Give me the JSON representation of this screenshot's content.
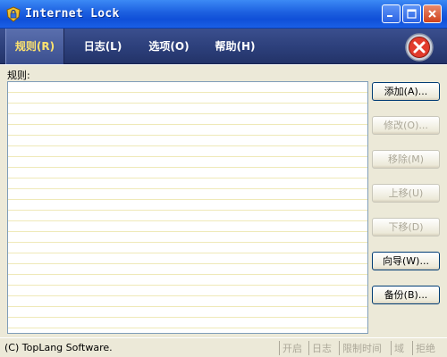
{
  "window": {
    "title": "Internet Lock"
  },
  "menu": {
    "rules": "规则(R)",
    "log": "日志(L)",
    "options": "选项(O)",
    "help": "帮助(H)"
  },
  "rules_panel": {
    "label": "规则:",
    "buttons": {
      "add": "添加(A)...",
      "edit": "修改(O)...",
      "remove": "移除(M)",
      "move_up": "上移(U)",
      "move_down": "下移(D)",
      "wizard": "向导(W)...",
      "backup": "备份(B)..."
    }
  },
  "status": {
    "copyright": "(C) TopLang Software.",
    "segments": [
      "开启",
      "日志",
      "限制时间",
      "域",
      "拒绝"
    ]
  },
  "colors": {
    "menu_active_text": "#ffe36e",
    "list_line": "#efe9b8",
    "disabled_text": "#aca899"
  },
  "icons": {
    "app": "padlock-shield-icon",
    "close_big": "red-x-icon"
  }
}
